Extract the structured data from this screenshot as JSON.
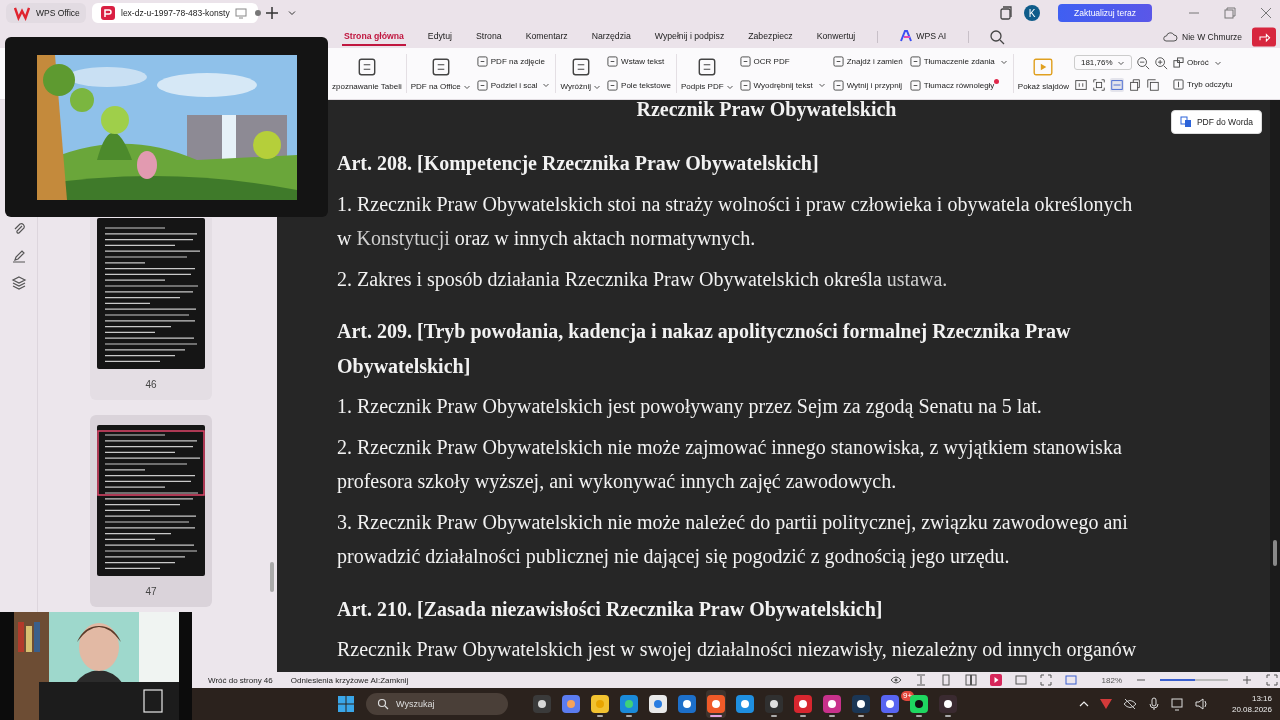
{
  "title_bar": {
    "tabs": [
      {
        "label": "WPS Office",
        "selected": false
      },
      {
        "label": "lex-dz-u-1997-78-483-konsty",
        "selected": true
      }
    ],
    "avatar": "K",
    "update_button": "Zaktualizuj teraz"
  },
  "menu_tabs": [
    {
      "label": "Strona główna",
      "selected": true
    },
    {
      "label": "Edytuj",
      "selected": false
    },
    {
      "label": "Strona",
      "selected": false
    },
    {
      "label": "Komentarz",
      "selected": false
    },
    {
      "label": "Narzędzia",
      "selected": false
    },
    {
      "label": "Wypełnij i podpisz",
      "selected": false
    },
    {
      "label": "Zabezpiecz",
      "selected": false
    },
    {
      "label": "Konwertuj",
      "selected": false
    },
    {
      "label": "WPS AI",
      "selected": false
    }
  ],
  "cloud_status": "Nie W Chmurze",
  "ribbon": {
    "groups": [
      {
        "items": [
          {
            "kind": "large",
            "label": "zpoznawanie Tabeli",
            "dropdown": false,
            "badge": false
          }
        ]
      },
      {
        "items": [
          {
            "kind": "large",
            "label": "PDF na Office",
            "dropdown": true,
            "badge": false
          },
          {
            "kind": "small",
            "label": "PDF na zdjęcie",
            "dropdown": false,
            "badge": false
          },
          {
            "kind": "small",
            "label": "Podziel i scal",
            "dropdown": true,
            "badge": false
          }
        ]
      },
      {
        "items": [
          {
            "kind": "large",
            "label": "Wyróżnij",
            "dropdown": true,
            "badge": false
          },
          {
            "kind": "small",
            "label": "Wstaw tekst",
            "dropdown": false,
            "badge": false
          },
          {
            "kind": "small",
            "label": "Pole tekstowe",
            "dropdown": false,
            "badge": false
          }
        ]
      },
      {
        "items": [
          {
            "kind": "large",
            "label": "Podpis PDF",
            "dropdown": true,
            "badge": false
          },
          {
            "kind": "small",
            "label": "OCR PDF",
            "dropdown": false,
            "badge": false
          },
          {
            "kind": "small",
            "label": "Wyodrębnij tekst",
            "dropdown": true,
            "badge": false
          },
          {
            "kind": "small",
            "label": "Znajdź i zamień",
            "dropdown": false,
            "badge": false
          },
          {
            "kind": "small",
            "label": "Wytnij i przypnij",
            "dropdown": false,
            "badge": false
          },
          {
            "kind": "small",
            "label": "Tłumaczenie zdania",
            "dropdown": true,
            "badge": false
          },
          {
            "kind": "small",
            "label": "Tłumacz równoległy",
            "dropdown": false,
            "badge": true
          }
        ]
      }
    ],
    "view": {
      "slideshow": "Pokaż slajdów",
      "zoom": "181,76%",
      "rotate": "Obróć",
      "reading_mode": "Tryb odczytu"
    }
  },
  "thumbnails": [
    {
      "page": "46",
      "selected": false
    },
    {
      "page": "47",
      "selected": true
    }
  ],
  "pdf_to_word_button": "PDF do Worda",
  "document": {
    "blocks": [
      {
        "kind": "title",
        "parts": [
          {
            "text": "Rzecznik Praw Obywatelskich",
            "link": false
          }
        ]
      },
      {
        "kind": "heading",
        "parts": [
          {
            "text": "Art. 208. [Kompetencje Rzecznika Praw Obywatelskich]",
            "link": false
          }
        ]
      },
      {
        "kind": "paragraph",
        "parts": [
          {
            "text": "1. Rzecznik Praw Obywatelskich stoi na straży wolności i praw człowieka i obywatela określonych w ",
            "link": false
          },
          {
            "text": "Konstytucji",
            "link": true
          },
          {
            "text": " oraz w innych aktach normatywnych.",
            "link": false
          }
        ]
      },
      {
        "kind": "paragraph",
        "parts": [
          {
            "text": "2. Zakres i sposób działania Rzecznika Praw Obywatelskich określa ",
            "link": false
          },
          {
            "text": "ustawa.",
            "link": true
          }
        ]
      },
      {
        "kind": "heading",
        "parts": [
          {
            "text": "Art. 209. [Tryb powołania, kadencja i nakaz apolityczności formalnej Rzecznika Praw Obywatelskich]",
            "link": false
          }
        ]
      },
      {
        "kind": "paragraph",
        "parts": [
          {
            "text": "1. Rzecznik Praw Obywatelskich jest powoływany przez Sejm za zgodą Senatu na 5 lat.",
            "link": false
          }
        ]
      },
      {
        "kind": "paragraph",
        "parts": [
          {
            "text": "2. Rzecznik Praw Obywatelskich nie może zajmować innego stanowiska, z wyjątkiem stanowiska profesora szkoły wyższej, ani wykonywać innych zajęć zawodowych.",
            "link": false
          }
        ]
      },
      {
        "kind": "paragraph",
        "parts": [
          {
            "text": "3. Rzecznik Praw Obywatelskich nie może należeć do partii politycznej, związku zawodowego ani prowadzić działalności publicznej nie dającej się pogodzić z godnością jego urzędu.",
            "link": false
          }
        ]
      },
      {
        "kind": "heading",
        "parts": [
          {
            "text": "Art. 210. [Zasada niezawisłości Rzecznika Praw Obywatelskich]",
            "link": false
          }
        ]
      },
      {
        "kind": "paragraph",
        "parts": [
          {
            "text": "Rzecznik Praw Obywatelskich jest w swojej działalności niezawisły, niezależny od innych organów",
            "link": false
          }
        ]
      }
    ]
  },
  "status_bar": {
    "back_link": "Wróć do strony 46",
    "cross_refs": "Odniesienia krzyżowe AI:Zamknij",
    "zoom": "182%",
    "zoom_slider": {
      "level": 0.52
    }
  },
  "taskbar": {
    "search_placeholder": "Wyszukaj",
    "apps": [
      {
        "running": false,
        "selected": false
      },
      {
        "running": false,
        "selected": false
      },
      {
        "running": true,
        "selected": false
      },
      {
        "running": true,
        "selected": false
      },
      {
        "running": false,
        "selected": false
      },
      {
        "running": false,
        "selected": false
      },
      {
        "running": true,
        "selected": true
      },
      {
        "running": false,
        "selected": false
      },
      {
        "running": true,
        "selected": false
      },
      {
        "running": true,
        "selected": false
      },
      {
        "running": true,
        "selected": false
      },
      {
        "running": true,
        "selected": false
      },
      {
        "running": true,
        "selected": false
      },
      {
        "running": true,
        "selected": false
      },
      {
        "running": true,
        "selected": false
      }
    ],
    "notification_badge": "9+",
    "time": "13:16",
    "date": "20.08.2026"
  }
}
